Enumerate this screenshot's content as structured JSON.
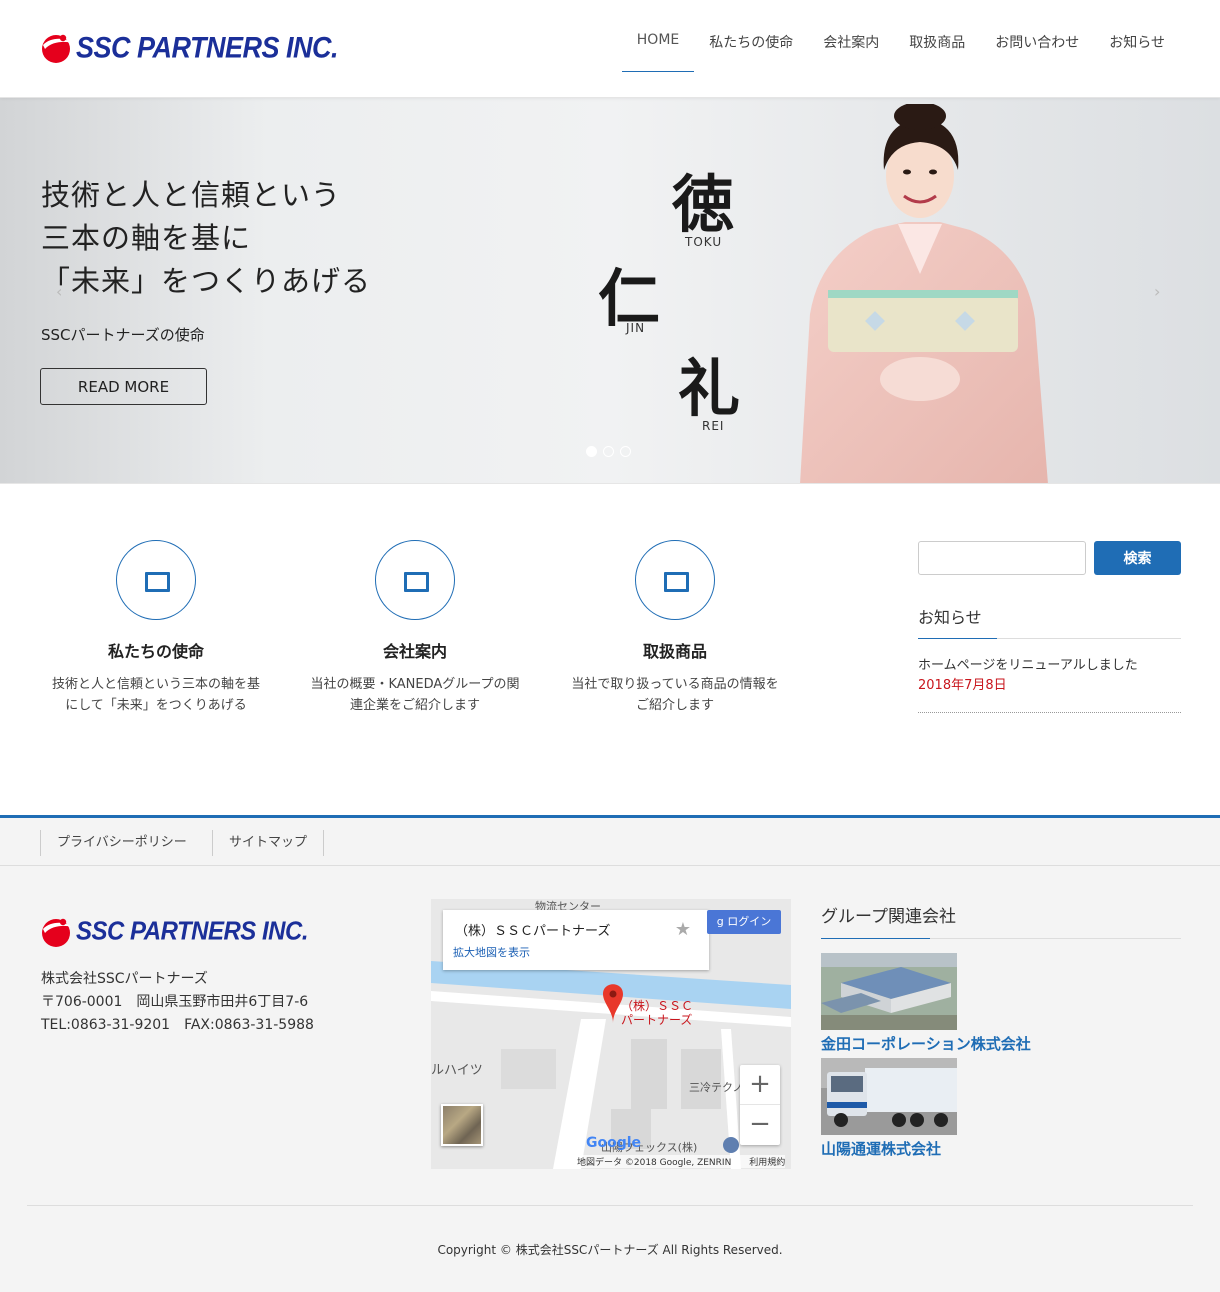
{
  "brand": {
    "name": "SSC PARTNERS INC.",
    "color": "#1b2f99",
    "mark_color": "#e5001c"
  },
  "nav": [
    {
      "label": "HOME"
    },
    {
      "label": "私たちの使命"
    },
    {
      "label": "会社案内"
    },
    {
      "label": "取扱商品"
    },
    {
      "label": "お問い合わせ"
    },
    {
      "label": "お知らせ"
    }
  ],
  "hero": {
    "title_lines": [
      "技術と人と信頼という",
      "三本の軸を基に",
      "「未来」をつくりあげる"
    ],
    "subtitle": "SSCパートナーズの使命",
    "button": "READ MORE",
    "prev_arrow": "‹",
    "next_arrow": "›",
    "kanji": [
      {
        "char": "徳",
        "roman": "TOKU"
      },
      {
        "char": "仁",
        "roman": "JIN"
      },
      {
        "char": "礼",
        "roman": "REI"
      }
    ],
    "slides_total": 3,
    "slide_active": 1
  },
  "features": [
    {
      "title": "私たちの使命",
      "desc_lines": [
        "技術と人と信頼という三本の軸を基",
        "にして「未来」をつくりあげる"
      ]
    },
    {
      "title": "会社案内",
      "desc_lines": [
        "当社の概要・KANEDAグループの関",
        "連企業をご紹介します"
      ]
    },
    {
      "title": "取扱商品",
      "desc_lines": [
        "当社で取り扱っている商品の情報を",
        "ご紹介します"
      ]
    }
  ],
  "sidebar": {
    "search_button": "検索",
    "search_value": "",
    "news_title": "お知らせ",
    "news": [
      {
        "title": "ホームページをリニューアルしました",
        "date": "2018年7月8日"
      }
    ]
  },
  "footer": {
    "links": [
      "プライバシーポリシー",
      "サイトマップ"
    ],
    "company": "株式会社SSCパートナーズ",
    "address": "〒706-0001　岡山県玉野市田井6丁目7-6",
    "tel_fax": "TEL:0863-31-9201　FAX:0863-31-5988",
    "map": {
      "place": "（株）ＳＳＣパートナーズ",
      "enlarge_link": "拡大地図を表示",
      "login": "ログイン",
      "login_icon": "g",
      "star_icon": "★",
      "pin_label_lines": [
        "（株）ＳＳＣ",
        "パートナーズ"
      ],
      "labels": [
        "物流センター",
        "ルハイツ",
        "三冷テクノ",
        "山陽フェックス(株)"
      ],
      "zoom_in": "+",
      "zoom_out": "−",
      "google": "Google",
      "credit": "地図データ ©2018 Google, ZENRIN　　利用規約"
    },
    "group_title": "グループ関連会社",
    "group": [
      {
        "name": "金田コーポレーション株式会社"
      },
      {
        "name": "山陽通運株式会社"
      }
    ],
    "copyright": "Copyright © 株式会社SSCパートナーズ All Rights Reserved."
  },
  "colors": {
    "accent": "#1f6db5",
    "date": "#c9161d",
    "footer_bg": "#f4f4f4"
  }
}
